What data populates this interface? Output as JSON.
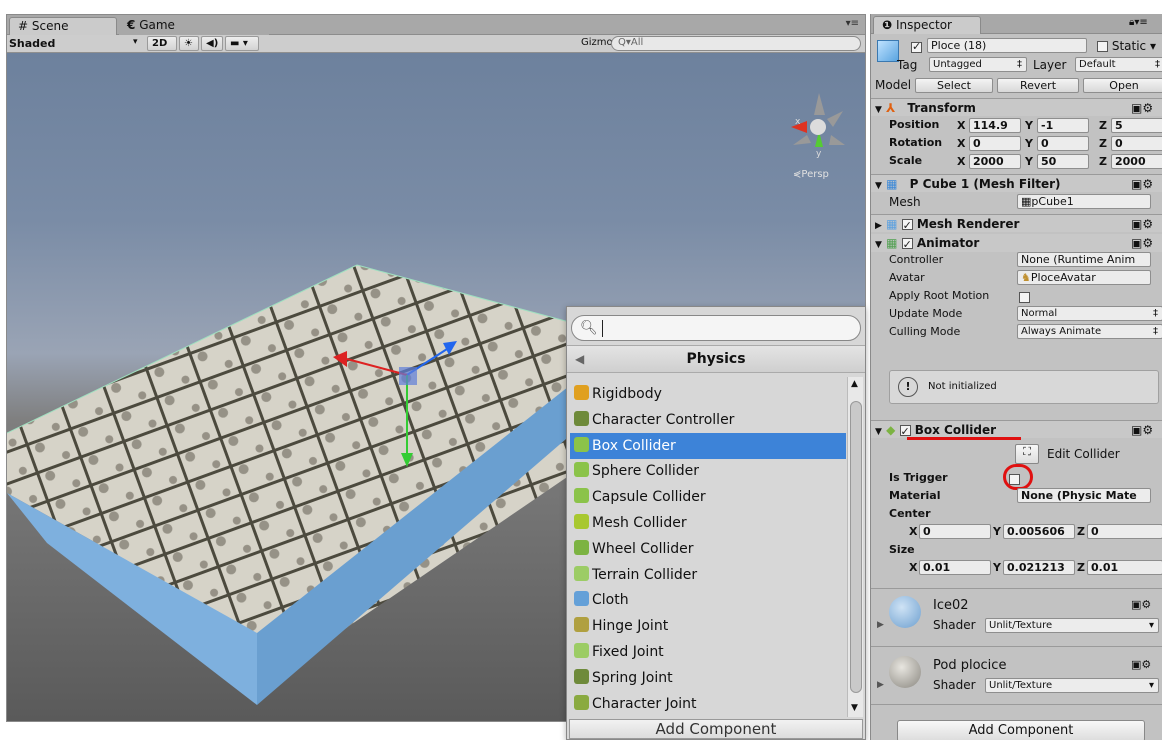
{
  "scene": {
    "tab_scene": "Scene",
    "tab_game": "Game",
    "shading": "Shaded",
    "mode_2d": "2D",
    "gizmos": "Gizmos",
    "search_placeholder": "All",
    "persp_label": "Persp",
    "axis_y": "y",
    "axis_x": "x"
  },
  "popup": {
    "search_value": "",
    "category": "Physics",
    "items": [
      {
        "label": "Rigidbody",
        "icon": "rigidbody-icon",
        "color": "#e0a020"
      },
      {
        "label": "Character Controller",
        "icon": "character-controller-icon",
        "color": "#6e8a3a"
      },
      {
        "label": "Box Collider",
        "icon": "box-collider-icon",
        "color": "#8bc34a",
        "selected": true
      },
      {
        "label": "Sphere Collider",
        "icon": "sphere-collider-icon",
        "color": "#8bc34a"
      },
      {
        "label": "Capsule Collider",
        "icon": "capsule-collider-icon",
        "color": "#8bc34a"
      },
      {
        "label": "Mesh Collider",
        "icon": "mesh-collider-icon",
        "color": "#a8c830"
      },
      {
        "label": "Wheel Collider",
        "icon": "wheel-collider-icon",
        "color": "#7cb342"
      },
      {
        "label": "Terrain Collider",
        "icon": "terrain-collider-icon",
        "color": "#9ccc65"
      },
      {
        "label": "Cloth",
        "icon": "cloth-icon",
        "color": "#64a0d8"
      },
      {
        "label": "Hinge Joint",
        "icon": "hinge-joint-icon",
        "color": "#b0a040"
      },
      {
        "label": "Fixed Joint",
        "icon": "fixed-joint-icon",
        "color": "#9ccc65"
      },
      {
        "label": "Spring Joint",
        "icon": "spring-joint-icon",
        "color": "#6e8a3a"
      },
      {
        "label": "Character Joint",
        "icon": "character-joint-icon",
        "color": "#8aaa40"
      }
    ],
    "add_component": "Add Component"
  },
  "inspector": {
    "tab": "Inspector",
    "object_name": "Ploce (18)",
    "static_label": "Static",
    "tag_label": "Tag",
    "tag_value": "Untagged",
    "layer_label": "Layer",
    "layer_value": "Default",
    "model_label": "Model",
    "model_select": "Select",
    "model_revert": "Revert",
    "model_open": "Open",
    "transform": {
      "title": "Transform",
      "position_label": "Position",
      "rotation_label": "Rotation",
      "scale_label": "Scale",
      "x": "X",
      "y": "Y",
      "z": "Z",
      "position": [
        "114.9",
        "-1",
        "5"
      ],
      "rotation": [
        "0",
        "0",
        "0"
      ],
      "scale": [
        "2000",
        "50",
        "2000"
      ]
    },
    "mesh_filter": {
      "title": "P Cube 1 (Mesh Filter)",
      "mesh_label": "Mesh",
      "mesh_value": "pCube1"
    },
    "mesh_renderer": {
      "title": "Mesh Renderer"
    },
    "animator": {
      "title": "Animator",
      "controller_label": "Controller",
      "controller_value": "None (Runtime Anim",
      "avatar_label": "Avatar",
      "avatar_value": "PloceAvatar",
      "root_motion_label": "Apply Root Motion",
      "update_label": "Update Mode",
      "update_value": "Normal",
      "culling_label": "Culling Mode",
      "culling_value": "Always Animate",
      "notice": "Not initialized"
    },
    "box_collider": {
      "title": "Box Collider",
      "edit_label": "Edit Collider",
      "trigger_label": "Is Trigger",
      "material_label": "Material",
      "material_value": "None (Physic Mate",
      "center_label": "Center",
      "center": [
        "0",
        "0.005606",
        "0"
      ],
      "size_label": "Size",
      "size": [
        "0.01",
        "0.021213",
        "0.01"
      ]
    },
    "material1": {
      "name": "Ice02",
      "shader_label": "Shader",
      "shader_value": "Unlit/Texture"
    },
    "material2": {
      "name": "Pod plocice",
      "shader_label": "Shader",
      "shader_value": "Unlit/Texture"
    },
    "add_component": "Add Component"
  },
  "colors": {
    "selection": "#3d83d8",
    "annotation": "#e01010"
  }
}
